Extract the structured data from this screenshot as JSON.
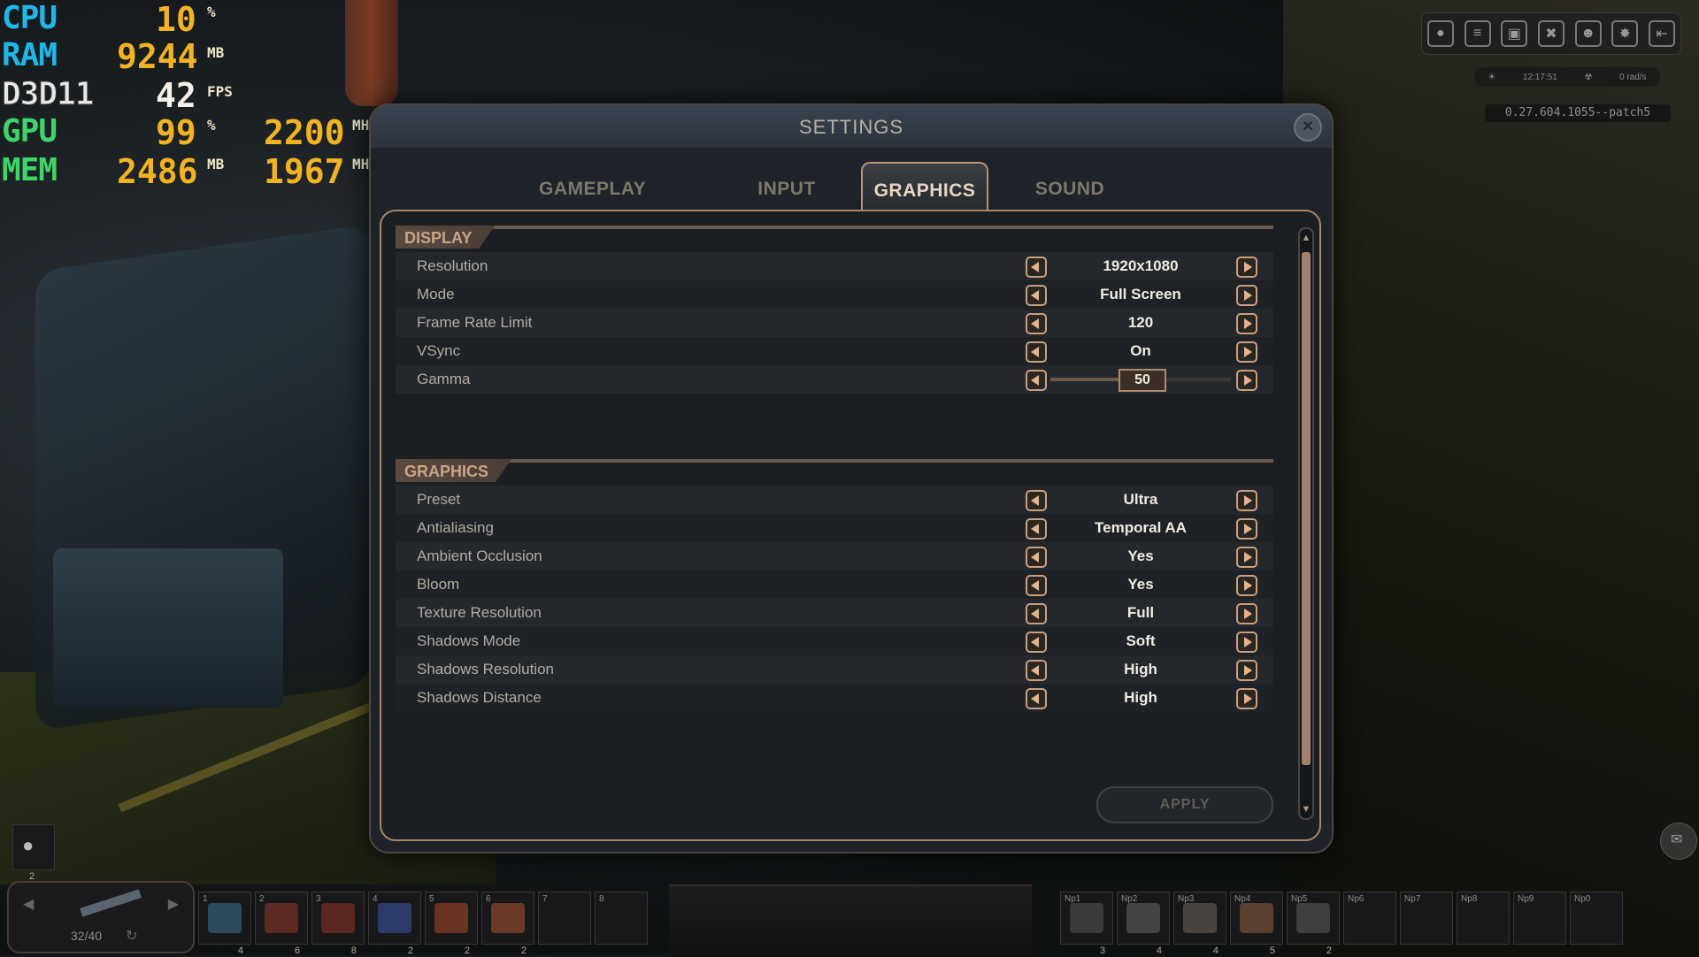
{
  "perf": {
    "cpu": {
      "name": "CPU",
      "value": "10",
      "unit": "%"
    },
    "ram": {
      "name": "RAM",
      "value": "9244",
      "unit": "MB"
    },
    "api": {
      "name": "D3D11",
      "value": "42",
      "unit": "FPS"
    },
    "gpu": {
      "name": "GPU",
      "value": "99",
      "unit": "%",
      "clock": "2200",
      "clock_unit": "MHz"
    },
    "mem": {
      "name": "MEM",
      "value": "2486",
      "unit": "MB",
      "clock": "1967",
      "clock_unit": "MHz"
    }
  },
  "hud": {
    "time": "12:17:51",
    "radiation": "0 rad/s",
    "version": "0.27.604.1055--patch5",
    "icons": [
      "map-pin-icon",
      "list-icon",
      "backpack-icon",
      "tools-icon",
      "character-icon",
      "skills-icon",
      "exit-icon"
    ]
  },
  "dialog": {
    "title": "SETTINGS",
    "tabs": [
      "GAMEPLAY",
      "INPUT",
      "GRAPHICS",
      "SOUND"
    ],
    "active_tab": "GRAPHICS",
    "sections": {
      "display": {
        "title": "DISPLAY",
        "rows": [
          {
            "label": "Resolution",
            "value": "1920x1080"
          },
          {
            "label": "Mode",
            "value": "Full Screen"
          },
          {
            "label": "Frame Rate Limit",
            "value": "120"
          },
          {
            "label": "VSync",
            "value": "On"
          }
        ],
        "gamma": {
          "label": "Gamma",
          "value": "50",
          "fraction": 0.5
        }
      },
      "graphics": {
        "title": "GRAPHICS",
        "rows": [
          {
            "label": "Preset",
            "value": "Ultra"
          },
          {
            "label": "Antialiasing",
            "value": "Temporal AA"
          },
          {
            "label": "Ambient Occlusion",
            "value": "Yes"
          },
          {
            "label": "Bloom",
            "value": "Yes"
          },
          {
            "label": "Texture Resolution",
            "value": "Full"
          },
          {
            "label": "Shadows Mode",
            "value": "Soft"
          },
          {
            "label": "Shadows Resolution",
            "value": "High"
          },
          {
            "label": "Shadows Distance",
            "value": "High"
          }
        ]
      }
    },
    "apply_label": "APPLY"
  },
  "hotbar": {
    "ammo": "32/40",
    "mask_count": "2",
    "slots": [
      {
        "num": "1",
        "count": "4"
      },
      {
        "num": "2",
        "count": "6"
      },
      {
        "num": "3",
        "count": "8"
      },
      {
        "num": "4",
        "count": "2"
      },
      {
        "num": "5",
        "count": "2"
      },
      {
        "num": "6",
        "count": "2"
      },
      {
        "num": "7",
        "count": ""
      },
      {
        "num": "8",
        "count": ""
      }
    ],
    "np_slots": [
      {
        "num": "Np1",
        "count": "3"
      },
      {
        "num": "Np2",
        "count": "4"
      },
      {
        "num": "Np3",
        "count": "4"
      },
      {
        "num": "Np4",
        "count": "5"
      },
      {
        "num": "Np5",
        "count": "2"
      },
      {
        "num": "Np6",
        "count": ""
      },
      {
        "num": "Np7",
        "count": ""
      },
      {
        "num": "Np8",
        "count": ""
      },
      {
        "num": "Np9",
        "count": ""
      },
      {
        "num": "Np0",
        "count": ""
      }
    ]
  },
  "colors": {
    "accent": "#c9a080",
    "panel_bg": "#1b1e22",
    "value_text": "#f0ece4"
  }
}
